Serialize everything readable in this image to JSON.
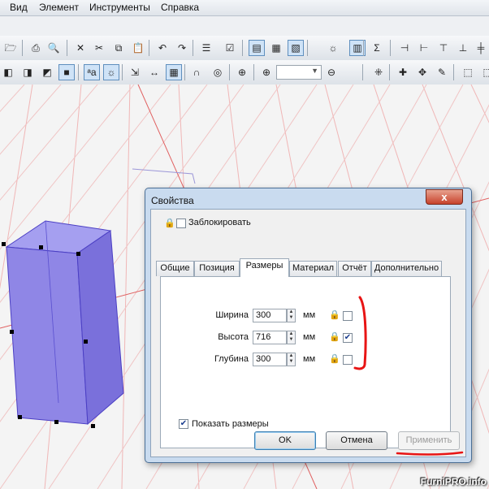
{
  "menu": {
    "items": [
      "Вид",
      "Элемент",
      "Инструменты",
      "Справка"
    ]
  },
  "toolbar1": [
    {
      "name": "open",
      "glyph": "🗁"
    },
    {
      "name": "print",
      "glyph": "⎙"
    },
    {
      "name": "preview",
      "glyph": "🔍"
    },
    {
      "name": "cut",
      "glyph": "✕"
    },
    {
      "name": "scissors",
      "glyph": "✂"
    },
    {
      "name": "copy",
      "glyph": "⧉"
    },
    {
      "name": "paste",
      "glyph": "📋"
    },
    {
      "name": "undo",
      "glyph": "↶"
    },
    {
      "name": "redo",
      "glyph": "↷"
    },
    {
      "name": "properties",
      "glyph": "☰"
    },
    {
      "name": "check",
      "glyph": "☑"
    },
    {
      "name": "view1",
      "glyph": "▤"
    },
    {
      "name": "view2",
      "glyph": "▦"
    },
    {
      "name": "view3",
      "glyph": "▧"
    },
    {
      "name": "bulb",
      "glyph": "☼"
    },
    {
      "name": "view4",
      "glyph": "▥"
    },
    {
      "name": "sigma",
      "glyph": "Σ"
    },
    {
      "name": "align1",
      "glyph": "⊣"
    },
    {
      "name": "align2",
      "glyph": "⊢"
    },
    {
      "name": "align3",
      "glyph": "⊤"
    },
    {
      "name": "align4",
      "glyph": "⊥"
    },
    {
      "name": "align5",
      "glyph": "╪"
    }
  ],
  "toolbar2": [
    {
      "name": "cube1",
      "glyph": "◧"
    },
    {
      "name": "cube2",
      "glyph": "◨"
    },
    {
      "name": "cube3",
      "glyph": "◩"
    },
    {
      "name": "cube4",
      "glyph": "■"
    },
    {
      "name": "text",
      "glyph": "ᵃa"
    },
    {
      "name": "light",
      "glyph": "☼"
    },
    {
      "name": "measure",
      "glyph": "⇲"
    },
    {
      "name": "dimension",
      "glyph": "↔"
    },
    {
      "name": "grid",
      "glyph": "▦"
    },
    {
      "name": "magnet",
      "glyph": "∩"
    },
    {
      "name": "target",
      "glyph": "◎"
    },
    {
      "name": "crosshair",
      "glyph": "⊕"
    },
    {
      "name": "zoom-in",
      "glyph": "⊕"
    },
    {
      "name": "zoom-out",
      "glyph": "⊖"
    },
    {
      "name": "select",
      "glyph": "⁜"
    },
    {
      "name": "add",
      "glyph": "✚"
    },
    {
      "name": "move",
      "glyph": "✥"
    },
    {
      "name": "edit",
      "glyph": "✎"
    },
    {
      "name": "frame1",
      "glyph": "⬚"
    },
    {
      "name": "frame2",
      "glyph": "⬚"
    }
  ],
  "dialog": {
    "title": "Свойства",
    "close_glyph": "x",
    "lock_label": "Заблокировать",
    "lock_checked": false,
    "tabs": [
      "Общие",
      "Позиция",
      "Размеры",
      "Материал",
      "Отчёт",
      "Дополнительно"
    ],
    "active_tab": "Размеры",
    "rows": [
      {
        "label": "Ширина",
        "value": "300",
        "unit": "мм",
        "locked": false
      },
      {
        "label": "Высота",
        "value": "716",
        "unit": "мм",
        "locked": true
      },
      {
        "label": "Глубина",
        "value": "300",
        "unit": "мм",
        "locked": false
      }
    ],
    "show_dims_label": "Показать размеры",
    "show_dims_checked": true,
    "buttons": {
      "ok": "OK",
      "cancel": "Отмена",
      "apply": "Применить"
    }
  },
  "watermark": "FurniPRO.info",
  "colors": {
    "box_fill": "#8f86e6",
    "box_edge": "#4b3fc4",
    "grid": "#e06060",
    "annotation": "#e81414"
  }
}
